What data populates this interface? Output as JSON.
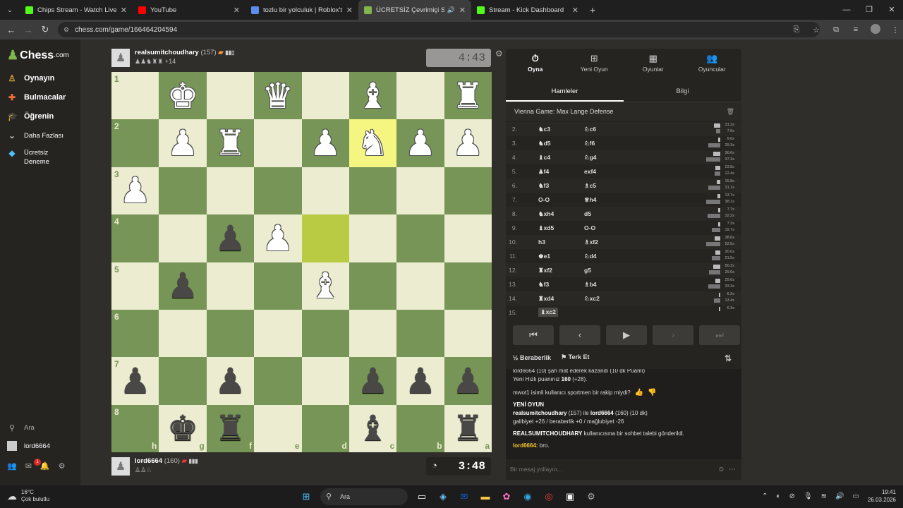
{
  "browser": {
    "tabs": [
      {
        "title": "Chips Stream - Watch Live on Kick",
        "favicon_color": "#53fc18",
        "active": false
      },
      {
        "title": "YouTube",
        "favicon_color": "#ff0000",
        "active": false
      },
      {
        "title": "tozlu bir yolculuk | Roblox'ta Oyna",
        "favicon_color": "#5a8dee",
        "active": false
      },
      {
        "title": "ÜCRETSİZ Çevrimiçi Satranç",
        "favicon_color": "#81b64c",
        "active": true
      },
      {
        "title": "Stream - Kick Dashboard",
        "favicon_color": "#53fc18",
        "active": false
      }
    ],
    "url": "chess.com/game/166464204594"
  },
  "sidebar": {
    "logo": "Chess",
    "logo_suffix": ".com",
    "items": [
      {
        "label": "Oynayın",
        "icon": "play-icon"
      },
      {
        "label": "Bulmacalar",
        "icon": "puzzle-icon"
      },
      {
        "label": "Öğrenin",
        "icon": "learn-icon"
      },
      {
        "label": "Daha Fazlası",
        "icon": "chevron-down-icon"
      },
      {
        "label": "Ücretsiz Deneme",
        "icon": "diamond-icon"
      }
    ],
    "search_label": "Ara",
    "username": "lord6664",
    "notification_count": "1"
  },
  "top_player": {
    "name": "realsumitchoudhary",
    "rating": "(157)",
    "captured": "+14",
    "clock": "4:43"
  },
  "bottom_player": {
    "name": "lord6664",
    "rating": "(160)",
    "clock": "3:48"
  },
  "board": {
    "ranks": [
      "1",
      "2",
      "3",
      "4",
      "5",
      "6",
      "7",
      "8"
    ],
    "files": [
      "h",
      "g",
      "f",
      "e",
      "d",
      "c",
      "b",
      "a"
    ],
    "rows": [
      [
        "",
        "wK",
        "",
        "wQ",
        "",
        "wB",
        "",
        "wR"
      ],
      [
        "",
        "wP",
        "wR",
        "",
        "wP",
        "wN",
        "wP",
        "wP"
      ],
      [
        "wP",
        "",
        "",
        "",
        "",
        "",
        "",
        ""
      ],
      [
        "",
        "",
        "bP",
        "wP",
        "",
        "",
        "",
        ""
      ],
      [
        "",
        "bP",
        "",
        "",
        "wB",
        "",
        "",
        ""
      ],
      [
        "",
        "",
        "",
        "",
        "",
        "",
        "",
        ""
      ],
      [
        "bP",
        "",
        "bP",
        "",
        "",
        "bP",
        "bP",
        "bP"
      ],
      [
        "",
        "bK",
        "bR",
        "",
        "",
        "bB",
        "",
        "bR"
      ]
    ],
    "highlights": [
      [
        1,
        5
      ],
      [
        3,
        4
      ]
    ]
  },
  "right_panel": {
    "tabs": [
      {
        "label": "Oyna",
        "icon": "clock-icon"
      },
      {
        "label": "Yeni Oyun",
        "icon": "plus-icon"
      },
      {
        "label": "Oyunlar",
        "icon": "board-icon"
      },
      {
        "label": "Oyuncular",
        "icon": "players-icon"
      }
    ],
    "subtabs": [
      "Hamleler",
      "Bilgi"
    ],
    "opening": "Vienna Game: Max Lange Defense",
    "moves": [
      {
        "n": "2.",
        "w": "♞c3",
        "b": "♘c6",
        "tw": "31.2s",
        "tb": "7.6s",
        "fw": 0.9,
        "fb": 0.3
      },
      {
        "n": "3.",
        "w": "♞d5",
        "b": "♘f6",
        "tw": "9.6s",
        "tb": "29.3s",
        "fw": 0.35,
        "fb": 0.85
      },
      {
        "n": "4.",
        "w": "♝c4",
        "b": "♘g4",
        "tw": "36.6s",
        "tb": "37.3s",
        "fw": 1.0,
        "fb": 1.0
      },
      {
        "n": "5.",
        "w": "♟f4",
        "b": "exf4",
        "tw": "23.8s",
        "tb": "12.4s",
        "fw": 0.7,
        "fb": 0.4
      },
      {
        "n": "6.",
        "w": "♞f3",
        "b": "♗c5",
        "tw": "15.8s",
        "tb": "31.1s",
        "fw": 0.5,
        "fb": 0.85
      },
      {
        "n": "7.",
        "w": "O-O",
        "b": "♕h4",
        "tw": "13.7s",
        "tb": "38.1s",
        "fw": 0.45,
        "fb": 1.0
      },
      {
        "n": "8.",
        "w": "♞xh4",
        "b": "d5",
        "tw": "7.7s",
        "tb": "32.2s",
        "fw": 0.3,
        "fb": 0.9
      },
      {
        "n": "9.",
        "w": "♝xd5",
        "b": "O-O",
        "tw": "7.3s",
        "tb": "19.7s",
        "fw": 0.3,
        "fb": 0.6
      },
      {
        "n": "10.",
        "w": "h3",
        "b": "♗xf2",
        "tw": "38.6s",
        "tb": "52.5s",
        "fw": 0.8,
        "fb": 1.0
      },
      {
        "n": "11.",
        "w": "♚e1",
        "b": "♘d4",
        "tw": "30.0s",
        "tb": "21.5s",
        "fw": 0.75,
        "fb": 0.6
      },
      {
        "n": "12.",
        "w": "♜xf2",
        "b": "g5",
        "tw": "50.2s",
        "tb": "29.0s",
        "fw": 1.0,
        "fb": 0.8
      },
      {
        "n": "13.",
        "w": "♞f3",
        "b": "♗b4",
        "tw": "29.0s",
        "tb": "33.3s",
        "fw": 0.75,
        "fb": 0.85
      },
      {
        "n": "14.",
        "w": "♜xd4",
        "b": "♘xc2",
        "tw": "6.2s",
        "tb": "13.4s",
        "fw": 0.25,
        "fb": 0.45
      },
      {
        "n": "15.",
        "w": "♝xc2",
        "b": "",
        "tw": "6.3s",
        "tb": "",
        "fw": 0.25,
        "fb": 0
      }
    ],
    "controls": [
      "⏮",
      "‹",
      "▶",
      "›",
      "⏭"
    ],
    "draw_label": "Beraberlik",
    "resign_label": "Terk Et",
    "chat": {
      "line1": "lord6664 (10) şah mat ederek kazandı (10 dk Puanlı)",
      "line2a": "Yeni Hızlı puanınız ",
      "line2b": "160",
      "line2c": " (+28).",
      "sportsman": "mwot1 isimli kullanıcı sportmen bir rakip miydi?",
      "new_game": "YENİ OYUN",
      "game_a": "realsumitchoudhary",
      "game_b": " (157) ile ",
      "game_c": "lord6664",
      "game_d": " (160) (10 dk)",
      "record": "galibiyet +26 / beraberlik +0 / mağlubiyet -26",
      "friend_a": "REALSUMITCHOUDHARY",
      "friend_b": " kullanıcısına bir sohbet talebi gönderildi.",
      "msg_user": "lord6664:",
      "msg_text": " bro.",
      "placeholder": "Bir mesaj yollayın..."
    }
  },
  "taskbar": {
    "temp": "16°C",
    "weather": "Çok bulutlu",
    "search": "Ara",
    "time": "19:41",
    "date": "26.03.2026"
  }
}
